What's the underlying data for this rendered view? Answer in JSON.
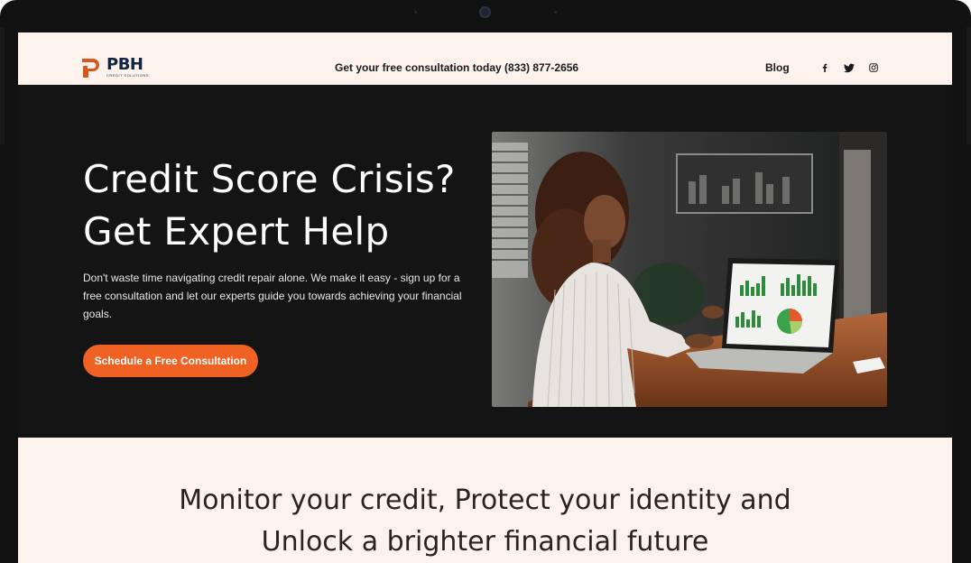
{
  "brand": {
    "name": "PBH",
    "tagline": "CREDIT SOLUTIONS",
    "color": "#0f2540",
    "accent": "#d8561e"
  },
  "header": {
    "consultation_text": "Get your free consultation today (833) 877-2656",
    "blog_label": "Blog",
    "social": [
      "facebook-icon",
      "twitter-icon",
      "instagram-icon"
    ]
  },
  "hero": {
    "title_line1": "Credit Score Crisis?",
    "title_line2": "Get Expert Help",
    "description": "Don't waste time navigating credit repair alone. We make it easy - sign up for a free consultation and let our experts guide you towards achieving your financial goals.",
    "cta_label": "Schedule a Free Consultation",
    "cta_color": "#ef6224",
    "image_alt": "Woman reviewing financial charts on a laptop"
  },
  "section": {
    "title_line1": "Monitor your credit, Protect your identity and",
    "title_line2": "Unlock a brighter financial future"
  },
  "colors": {
    "page_bg": "#fdf3ec",
    "hero_bg": "#141414",
    "text_dark": "#2a2421"
  }
}
